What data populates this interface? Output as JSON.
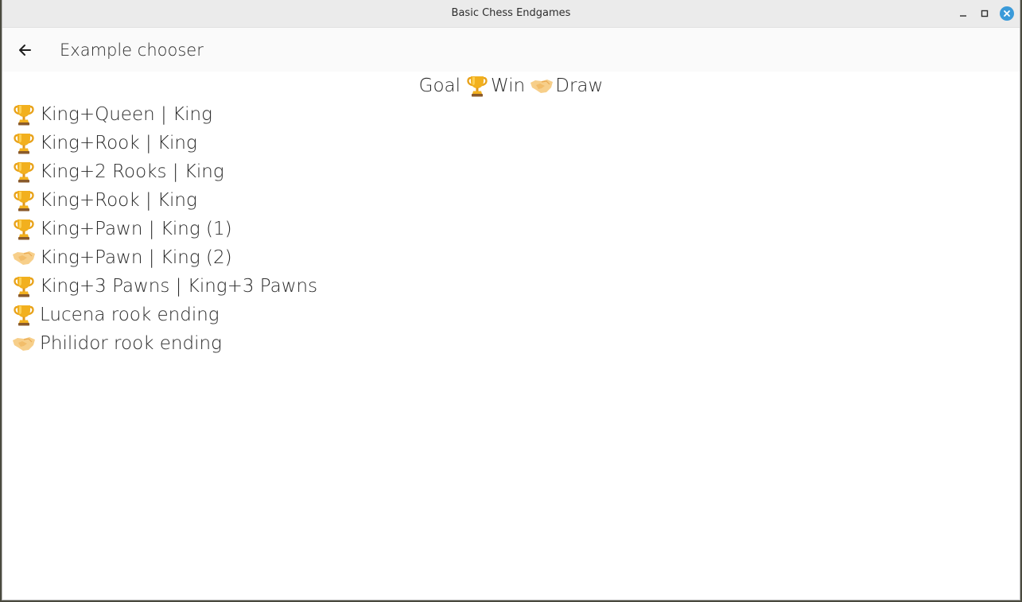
{
  "window": {
    "title": "Basic Chess Endgames"
  },
  "appbar": {
    "title": "Example chooser"
  },
  "goal": {
    "label": "Goal",
    "win_label": "Win",
    "draw_label": "Draw"
  },
  "examples": [
    {
      "label": "King+Queen | King",
      "goal": "win"
    },
    {
      "label": "King+Rook | King",
      "goal": "win"
    },
    {
      "label": "King+2 Rooks | King",
      "goal": "win"
    },
    {
      "label": "King+Rook | King",
      "goal": "win"
    },
    {
      "label": "King+Pawn | King (1)",
      "goal": "win"
    },
    {
      "label": "King+Pawn | King (2)",
      "goal": "draw"
    },
    {
      "label": "King+3 Pawns | King+3 Pawns",
      "goal": "win"
    },
    {
      "label": "Lucena rook ending",
      "goal": "win"
    },
    {
      "label": "Philidor rook ending",
      "goal": "draw"
    }
  ],
  "icons": {
    "win": "trophy-icon",
    "draw": "handshake-icon"
  },
  "colors": {
    "trophy": "#e8a21a",
    "handshake": "#f7cf8a",
    "close_button": "#3a9ad9"
  }
}
